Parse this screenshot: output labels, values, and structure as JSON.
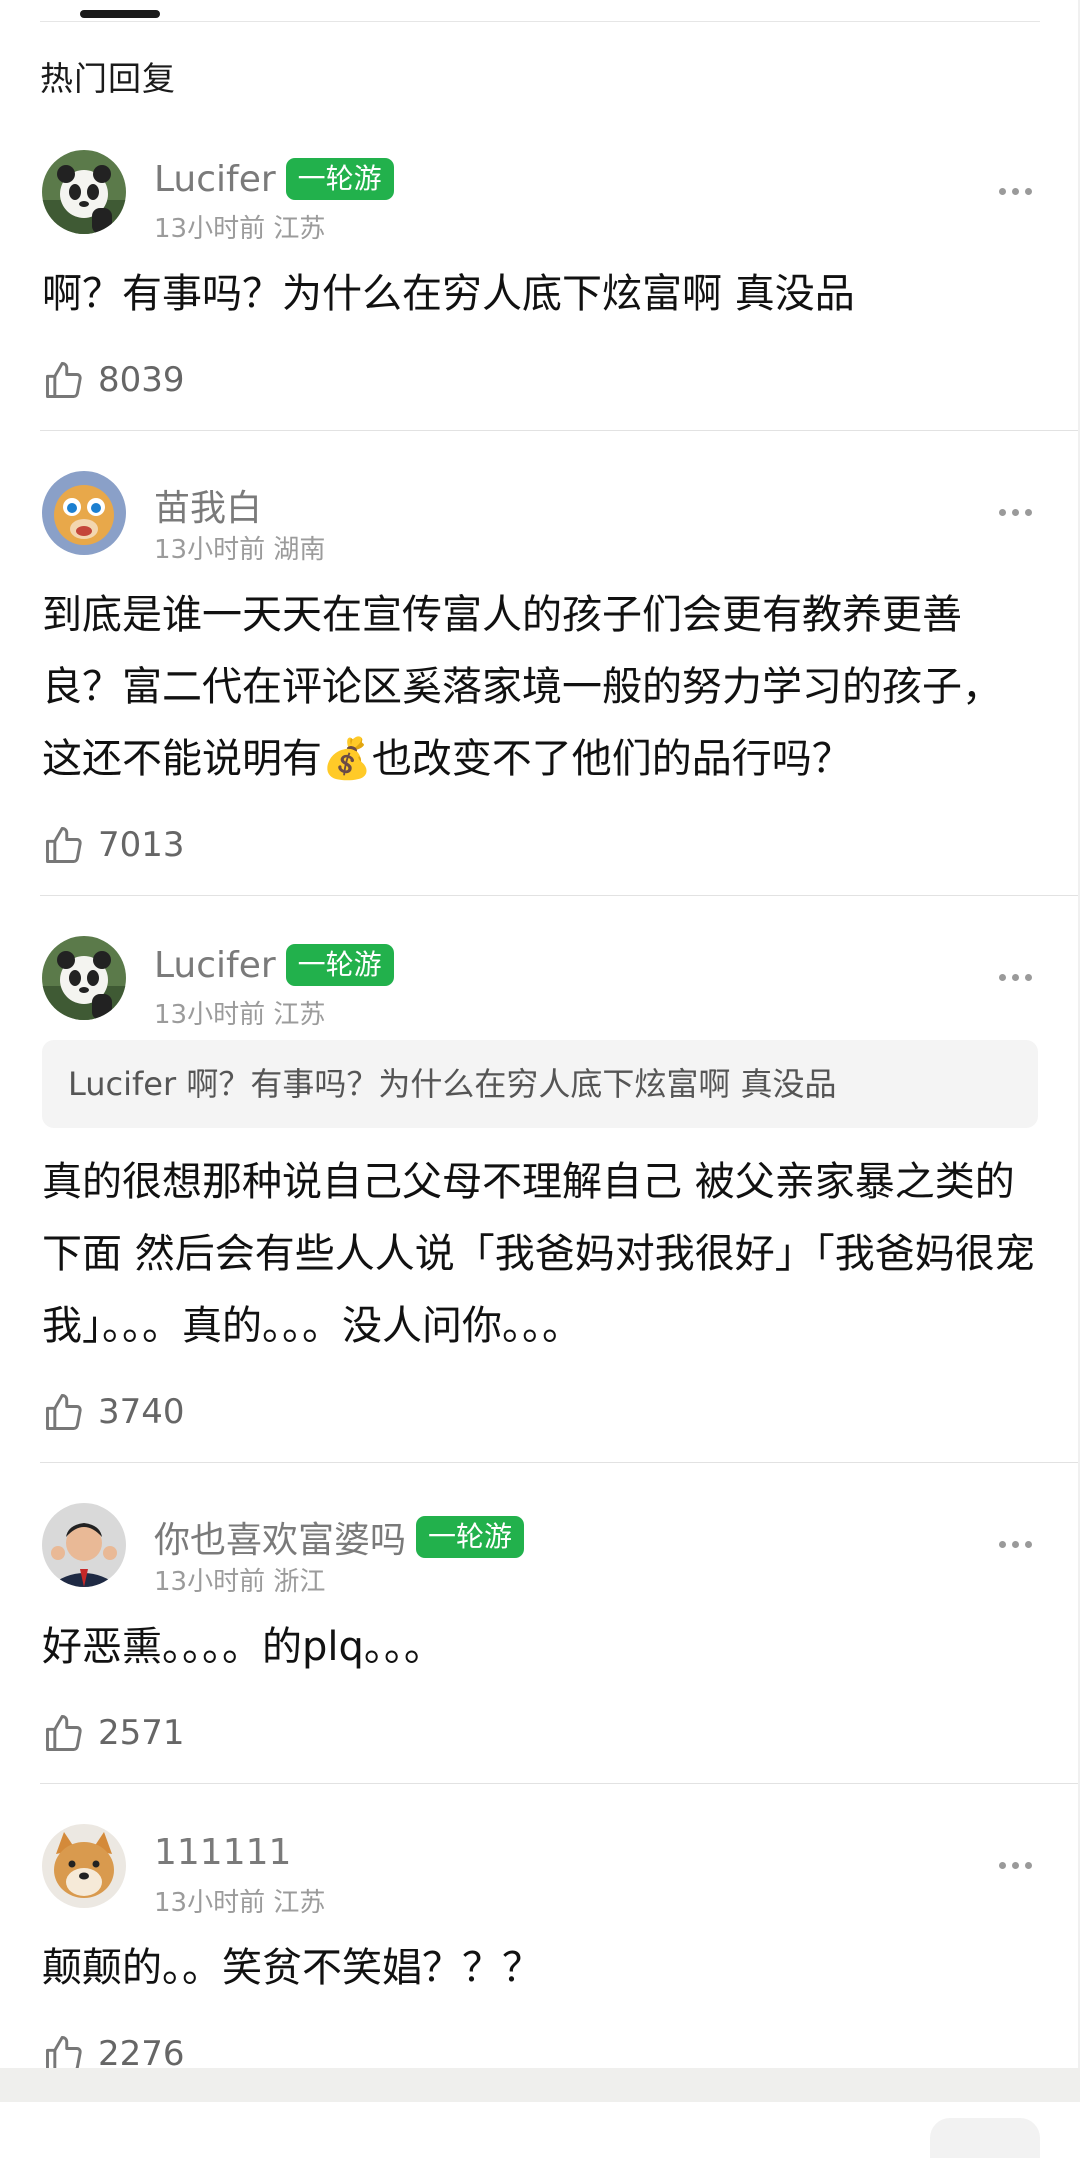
{
  "section_title": "热门回复",
  "comments": [
    {
      "user": "Lucifer",
      "badge": "一轮游",
      "meta": "13小时前 江苏",
      "text": "啊？有事吗？为什么在穷人底下炫富啊 真没品",
      "likes": "8039",
      "avatar_icon": "panda-avatar"
    },
    {
      "user": "苗我白",
      "badge": "",
      "meta": "13小时前 湖南",
      "text_before_emoji": "到底是谁一天天在宣传富人的孩子们会更有教养更善良？富二代在评论区奚落家境一般的努力学习的孩子，这还不能说明有",
      "emoji": "💰",
      "text_after_emoji": "也改变不了他们的品行吗？",
      "likes": "7013",
      "avatar_icon": "cartoon-duck-avatar"
    },
    {
      "user": "Lucifer",
      "badge": "一轮游",
      "meta": "13小时前 江苏",
      "quote": "Lucifer 啊？有事吗？为什么在穷人底下炫富啊 真没品",
      "text": "真的很想那种说自己父母不理解自己 被父亲家暴之类的下面 然后会有些人人说「我爸妈对我很好」「我爸妈很宠我」。。。真的。。。没人问你。。。",
      "likes": "3740",
      "avatar_icon": "panda-avatar"
    },
    {
      "user": "你也喜欢富婆吗",
      "badge": "一轮游",
      "meta": "13小时前 浙江",
      "text": "好恶熏。。。。的plq。。。",
      "likes": "2571",
      "avatar_icon": "man-in-suit-avatar"
    },
    {
      "user": "111111",
      "badge": "",
      "meta": "13小时前 江苏",
      "text": "颠颠的。。笑贫不笑娼？？？",
      "likes": "2276",
      "avatar_icon": "shiba-dog-avatar"
    }
  ],
  "colors": {
    "badge": "#22b14c",
    "name": "#7a7a7a",
    "meta": "#9b9b9b"
  }
}
